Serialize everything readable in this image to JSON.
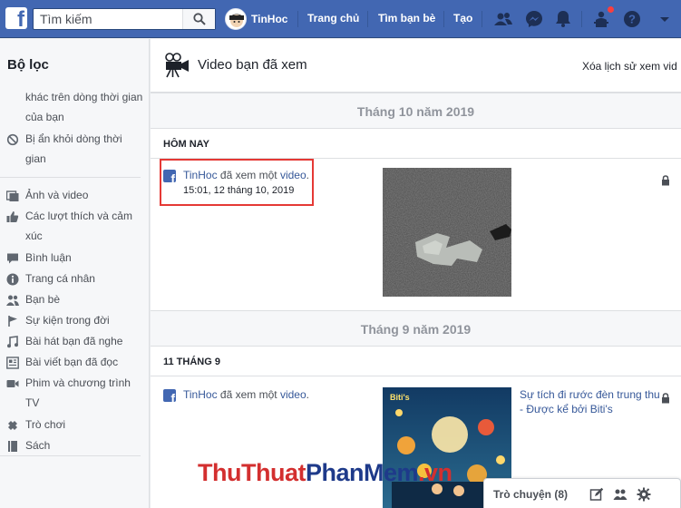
{
  "topbar": {
    "logo": "f",
    "search_placeholder": "Tìm kiếm",
    "profile_name": "TinHoc",
    "nav": [
      "Trang chủ",
      "Tìm bạn bè",
      "Tạo"
    ],
    "icons": [
      "friend-requests-icon",
      "messenger-icon",
      "notifications-icon",
      "quick-help-icon",
      "help-icon",
      "dropdown-arrow-icon"
    ],
    "brand_color": "#4267b2"
  },
  "sidebar": {
    "title": "Bộ lọc",
    "items": [
      {
        "label": "khác trên dòng thời gian của bạn",
        "icon": ""
      },
      {
        "label": "Bị ẩn khỏi dòng thời gian",
        "icon": "hidden-icon"
      },
      {
        "label": "Ảnh và video",
        "icon": "photos-icon"
      },
      {
        "label": "Các lượt thích và cảm xúc",
        "icon": "like-icon"
      },
      {
        "label": "Bình luận",
        "icon": "comment-icon"
      },
      {
        "label": "Trang cá nhân",
        "icon": "profile-info-icon"
      },
      {
        "label": "Bạn bè",
        "icon": "friends-icon"
      },
      {
        "label": "Sự kiện trong đời",
        "icon": "life-event-icon"
      },
      {
        "label": "Bài hát bạn đã nghe",
        "icon": "music-icon"
      },
      {
        "label": "Bài viết bạn đã đọc",
        "icon": "articles-icon"
      },
      {
        "label": "Phim và chương trình TV",
        "icon": "video-icon"
      },
      {
        "label": "Trò chơi",
        "icon": "games-icon"
      },
      {
        "label": "Sách",
        "icon": "books-icon"
      }
    ]
  },
  "main": {
    "title": "Video bạn đã xem",
    "clear_link": "Xóa lịch sử xem vid",
    "sections": [
      {
        "month": "Tháng 10 năm 2019",
        "day": "HÔM NAY",
        "entry": {
          "user": "TinHoc",
          "action": " đã xem một ",
          "object": "video",
          "end": ".",
          "time": "15:01, 12 tháng 10, 2019"
        }
      },
      {
        "month": "Tháng 9 năm 2019",
        "day": "11 THÁNG 9",
        "entry": {
          "user": "TinHoc",
          "action": " đã xem một ",
          "object": "video",
          "end": ".",
          "video_title": "Sự tích đi rước đèn trung thu - Được kể bởi Biti's"
        }
      }
    ]
  },
  "chat": {
    "label": "Trò chuyện (8)"
  },
  "watermark": {
    "part1": "ThuThuat",
    "part2": "PhanMem",
    "part3": ".vn"
  }
}
